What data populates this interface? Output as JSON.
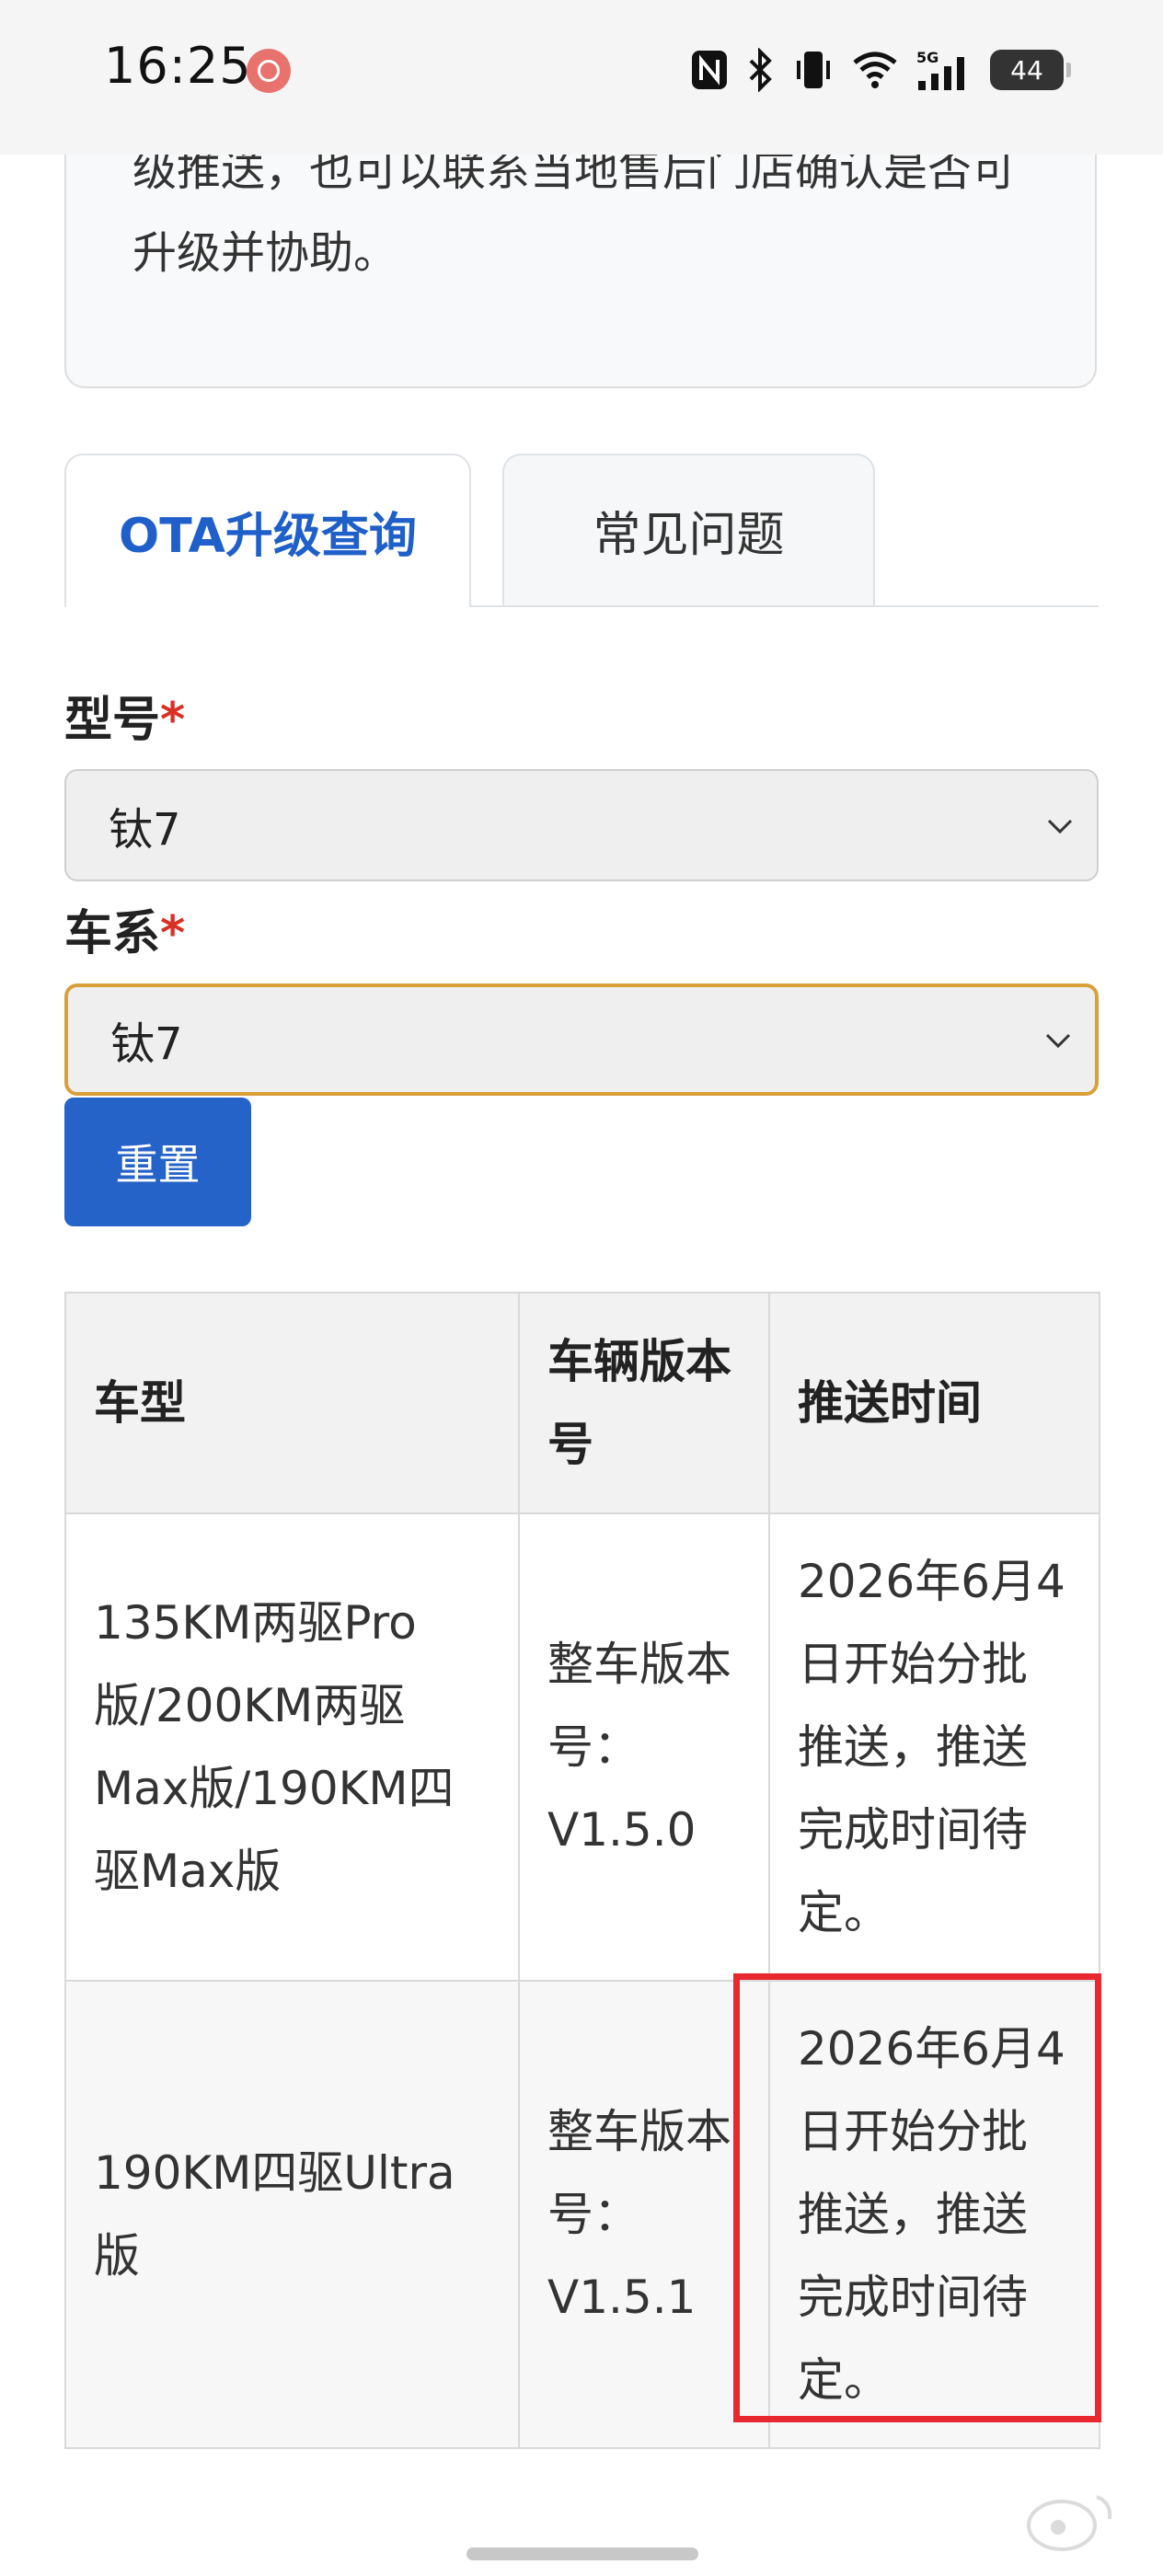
{
  "status_bar": {
    "time": "16:25",
    "battery": "44",
    "network": "5G",
    "icons": [
      "nfc-icon",
      "bluetooth-icon",
      "vibrate-icon",
      "wifi-icon",
      "signal-icon",
      "battery-icon"
    ]
  },
  "info_card": {
    "text": "级推送，也可以联系当地售后门店确认是否可升级并协助。"
  },
  "tabs": [
    {
      "label": "OTA升级查询",
      "active": true
    },
    {
      "label": "常见问题",
      "active": false
    }
  ],
  "form": {
    "model": {
      "label": "型号",
      "required_mark": "*",
      "value": "钛7"
    },
    "series": {
      "label": "车系",
      "required_mark": "*",
      "value": "钛7"
    },
    "reset_label": "重置"
  },
  "table": {
    "headers": [
      "车型",
      "车辆版本号",
      "推送时间"
    ],
    "rows": [
      {
        "model": "135KM两驱Pro版/200KM两驱Max版/190KM四驱Max版",
        "version": "整车版本号：V1.5.0",
        "push_time": "2026年6月4日开始分批推送，推送完成时间待定。"
      },
      {
        "model": "190KM四驱Ultra版",
        "version": "整车版本号：V1.5.1",
        "push_time": "2026年6月4日开始分批推送，推送完成时间待定。"
      }
    ]
  },
  "colors": {
    "accent": "#2563c8",
    "active_tab_text": "#1f5fc9",
    "required": "#d93025",
    "focus_border": "#d9a03a",
    "highlight": "#e8272e"
  }
}
